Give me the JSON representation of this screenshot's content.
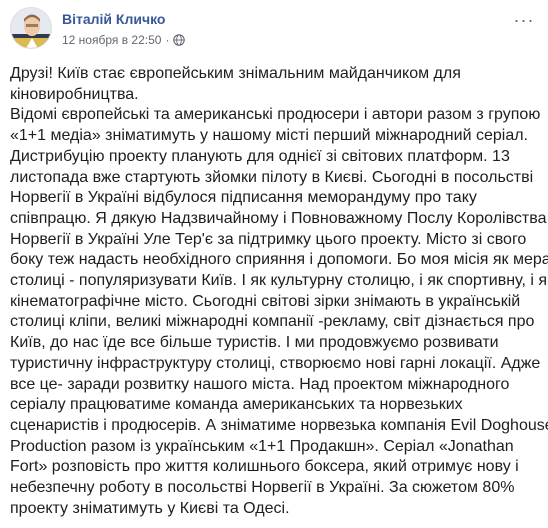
{
  "post": {
    "author_name": "Віталій Кличко",
    "timestamp": "12 ноября в 22:50",
    "separator": "·",
    "privacy_icon": "globe-icon",
    "more_icon": "more-options-icon",
    "more_label": "···",
    "text_lines": [
      "Друзі! Київ стає європейським знімальним майданчиком для",
      "кіновиробництва.",
      "Відомі європейські та американські продюсери і автори разом з групою",
      "«1+1 медіа» зніматимуть у нашому місті перший міжнародний серіал.",
      "Дистрибуцію проекту планують для однієї зі світових платформ. 13",
      "листопада вже стартують зйомки пілоту в Києві. Сьогодні в посольстві",
      "Норвегії в Україні відбулося підписання меморандуму про таку",
      "співпрацю. Я дякую Надзвичайному і Повноважному Послу Королівства",
      "Норвегії в Україні Уле Тер'є за підтримку цього проекту. Місто зі свого",
      "боку теж надасть необхідного сприяння і допомоги. Бо моя місія як мера",
      "столиці - популяризувати Київ. І як культурну столицю, і як спортивну, і як",
      "кінематографічне місто. Сьогодні світові зірки знімають в українській",
      "столиці кліпи, великі міжнародні компанії -рекламу, світ дізнається про",
      "Київ, до нас їде все більше туристів. І ми продовжуємо розвивати",
      "туристичну інфраструктуру столиці, створюємо нові гарні локації. Адже",
      "все це- заради розвитку нашого міста. Над проектом міжнародного",
      "серіалу працюватиме команда американських та норвезьких",
      "сценаристів і продюсерів. А зніматиме норвезька компанія Evil Doghouse",
      "Production разом із українським «1+1 Продакшн». Серіал «Jonathan",
      "Fort» розповість про життя колишнього боксера, який отримує нову і",
      "небезпечну роботу в посольстві Норвегії в Україні. За сюжетом 80%",
      "проекту зніматимуть у Києві та Одесі."
    ]
  },
  "colors": {
    "author_link": "#385898",
    "meta_text": "#616770",
    "body_text": "#1c1e21",
    "background": "#ffffff"
  }
}
